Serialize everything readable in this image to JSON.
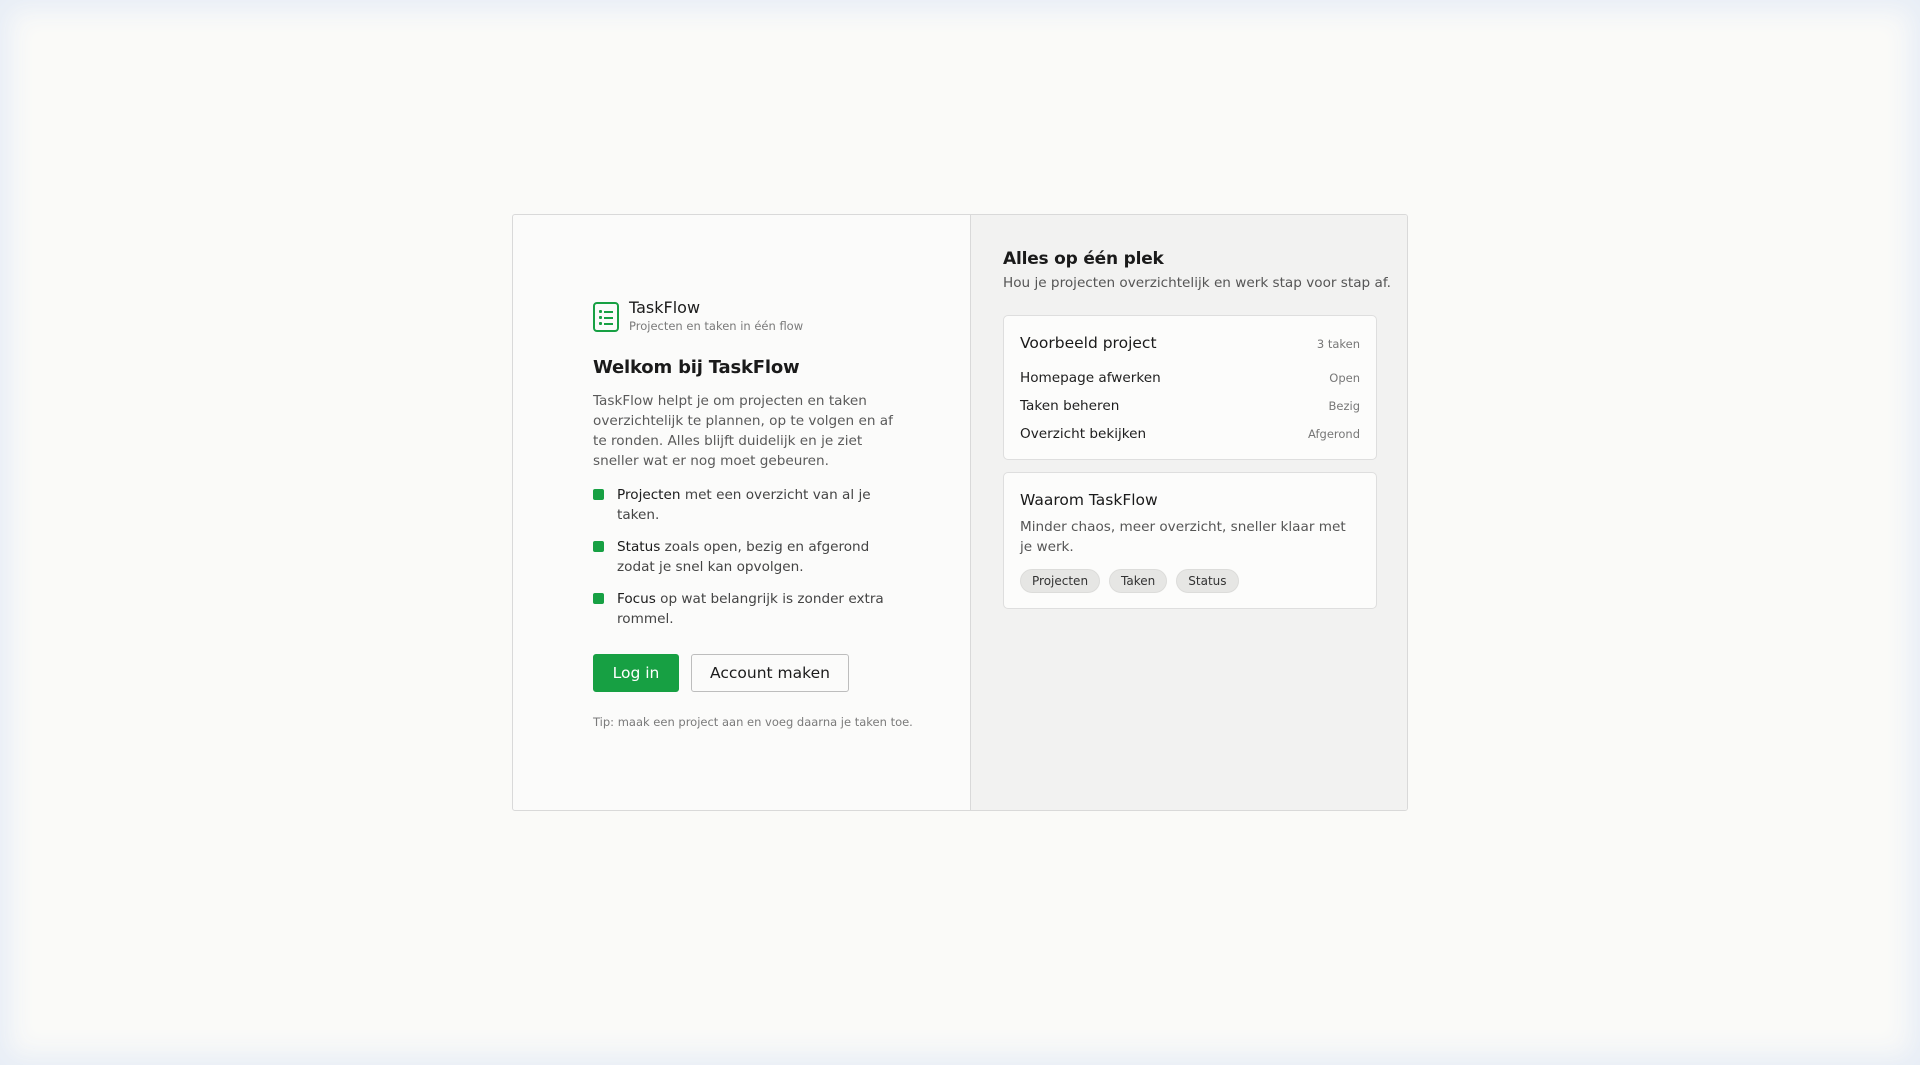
{
  "brand": {
    "name": "TaskFlow",
    "tagline": "Projecten en taken in één flow",
    "icon": "task-list-icon",
    "accent_color": "#17a043"
  },
  "welcome": {
    "title": "Welkom bij TaskFlow",
    "description": "TaskFlow helpt je om projecten en taken overzichtelijk te plannen, op te volgen en af te ronden. Alles blijft duidelijk en je ziet sneller wat er nog moet gebeuren."
  },
  "features": [
    {
      "bold": "Projecten",
      "text": " met een overzicht van al je taken."
    },
    {
      "bold": "Status",
      "text": " zoals open, bezig en afgerond zodat je snel kan opvolgen."
    },
    {
      "bold": "Focus",
      "text": " op wat belangrijk is zonder extra rommel."
    }
  ],
  "actions": {
    "login_label": "Log in",
    "signup_label": "Account maken"
  },
  "tip": "Tip: maak een project aan en voeg daarna je taken toe.",
  "sidebar": {
    "title": "Alles op één plek",
    "subtitle": "Hou je projecten overzichtelijk en werk stap voor stap af.",
    "example_project": {
      "title": "Voorbeeld project",
      "count": "3 taken",
      "tasks": [
        {
          "name": "Homepage afwerken",
          "status": "Open"
        },
        {
          "name": "Taken beheren",
          "status": "Bezig"
        },
        {
          "name": "Overzicht bekijken",
          "status": "Afgerond"
        }
      ]
    },
    "why": {
      "title": "Waarom TaskFlow",
      "description": "Minder chaos, meer overzicht, sneller klaar met je werk.",
      "tags": [
        "Projecten",
        "Taken",
        "Status"
      ]
    }
  }
}
